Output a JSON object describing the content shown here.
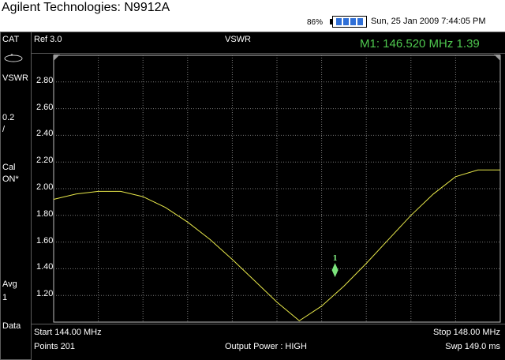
{
  "window": {
    "title": "Agilent Technologies: N9912A",
    "battery_percent": "86%",
    "datetime": "Sun, 25 Jan 2009 7:44:05 PM"
  },
  "sidebar": {
    "cat": "CAT",
    "vswr": "VSWR",
    "scale_value": "0.2",
    "scale_unit": "/",
    "cal_label": "Cal",
    "cal_state": "ON*",
    "avg_label": "Avg",
    "avg_value": "1",
    "data_label": "Data"
  },
  "header": {
    "ref": "Ref 3.0",
    "mode": "VSWR",
    "marker_readout": "M1:  146.520 MHz  1.39"
  },
  "marker": {
    "label": "1",
    "freq_mhz": 146.52,
    "value": 1.39
  },
  "footer": {
    "start": "Start 144.00 MHz",
    "stop": "Stop 148.00 MHz",
    "points": "Points 201",
    "output_power": "Output Power : HIGH",
    "sweep": "Swp 149.0 ms"
  },
  "colors": {
    "trace": "#e8e84a",
    "marker": "#7be37b",
    "grid": "#7a7a7a",
    "readout": "#4fc94f"
  },
  "chart_data": {
    "type": "line",
    "x_range_mhz": [
      144.0,
      148.0
    ],
    "ylim": [
      1.0,
      3.0
    ],
    "y_ticks": [
      "2.80",
      "2.60",
      "2.40",
      "2.20",
      "2.00",
      "1.80",
      "1.60",
      "1.40",
      "1.20"
    ],
    "grid": true,
    "series": [
      {
        "x": [
          144.0,
          144.2,
          144.4,
          144.6,
          144.8,
          145.0,
          145.2,
          145.4,
          145.6,
          145.8,
          146.0,
          146.2,
          146.4,
          146.6,
          146.8,
          147.0,
          147.2,
          147.4,
          147.6,
          147.8,
          148.0
        ],
        "values": [
          1.92,
          1.96,
          1.98,
          1.98,
          1.94,
          1.86,
          1.75,
          1.62,
          1.47,
          1.31,
          1.15,
          1.01,
          1.12,
          1.27,
          1.44,
          1.62,
          1.8,
          1.96,
          2.09,
          2.14,
          2.14
        ]
      }
    ]
  }
}
